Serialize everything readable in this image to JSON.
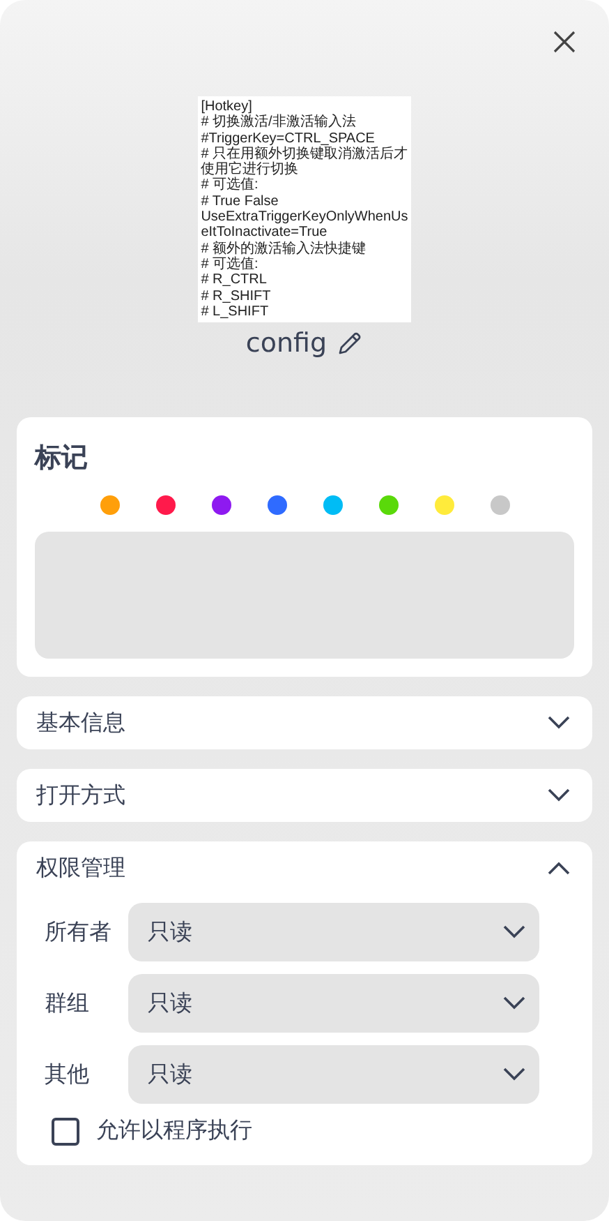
{
  "preview": {
    "lines": [
      "[Hotkey]",
      "# 切换激活/非激活输入法",
      "#TriggerKey=CTRL_SPACE",
      "# 只在用额外切换键取消激活后才",
      "使用它进行切换",
      "# 可选值:",
      "# True False",
      "UseExtraTriggerKeyOnlyWhenUs",
      "eItToInactivate=True",
      "# 额外的激活输入法快捷键",
      "# 可选值:",
      "# R_CTRL",
      "# R_SHIFT",
      "# L_SHIFT"
    ]
  },
  "file_name": "config",
  "tags": {
    "title": "标记",
    "colors": [
      {
        "color": "#ff9f0a"
      },
      {
        "color": "#ff1a4b"
      },
      {
        "color": "#8e1af0"
      },
      {
        "color": "#2f6bff"
      },
      {
        "color": "#00bcf5"
      },
      {
        "color": "#5ad90a"
      },
      {
        "color": "#ffeb3b"
      },
      {
        "color": "#c8c8c8"
      }
    ]
  },
  "sections": [
    {
      "title": "基本信息",
      "expanded": false
    },
    {
      "title": "打开方式",
      "expanded": false
    },
    {
      "title": "权限管理",
      "expanded": true,
      "permissions": [
        {
          "label": "所有者",
          "value": "只读"
        },
        {
          "label": "群组",
          "value": "只读"
        },
        {
          "label": "其他",
          "value": "只读"
        }
      ],
      "execute": {
        "label": "允许以程序执行",
        "checked": false
      }
    }
  ]
}
